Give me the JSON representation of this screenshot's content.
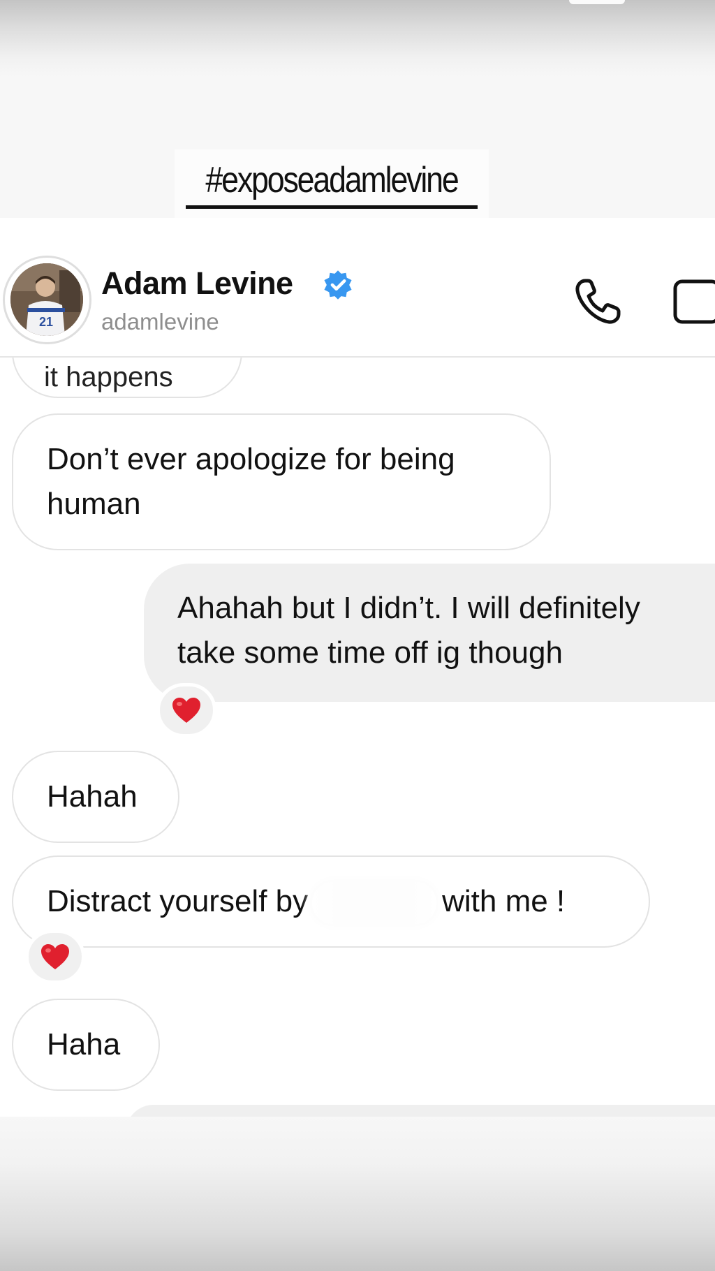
{
  "story": {
    "hashtag": "#exposeadamlevine"
  },
  "header": {
    "display_name": "Adam Levine",
    "username": "adamlevine",
    "avatar_jersey_number": "21",
    "icons": {
      "verified": "verified-badge-icon",
      "call": "phone-icon",
      "video": "video-camera-icon"
    },
    "accent_color": "#3897f0"
  },
  "messages": [
    {
      "from": "them",
      "text": "it happens",
      "partially_visible": true
    },
    {
      "from": "them",
      "lines": [
        "Don’t ever apologize for being",
        "human"
      ]
    },
    {
      "from": "me",
      "lines": [
        "Ahahah but I didn’t. I will definitely",
        "take some time off ig though"
      ],
      "reaction": "❤️"
    },
    {
      "from": "them",
      "text": "Hahah"
    },
    {
      "from": "them",
      "text_before": "Distract yourself by",
      "text_after": "with me !",
      "redacted": true,
      "reaction": "❤️"
    },
    {
      "from": "them",
      "text": "Haha"
    }
  ]
}
